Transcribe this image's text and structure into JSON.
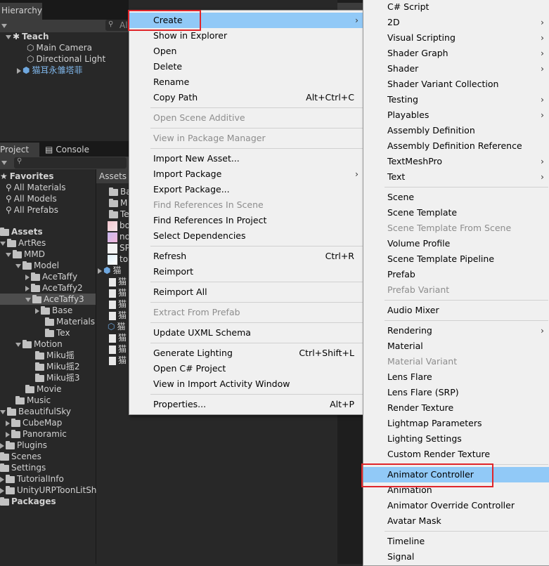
{
  "hierarchy": {
    "tab": "Hierarchy",
    "search_placeholder": "All",
    "scene": "Teach",
    "items": [
      "Main Camera",
      "Directional Light",
      "猫耳永雏塔菲"
    ]
  },
  "project": {
    "tab_project": "Project",
    "tab_console": "Console",
    "favorites": "Favorites",
    "fav_items": [
      "All Materials",
      "All Models",
      "All Prefabs"
    ],
    "assets": "Assets",
    "tree": [
      "ArtRes",
      "MMD",
      "Model",
      "AceTaffy",
      "AceTaffy2",
      "AceTaffy3",
      "Base",
      "Materials",
      "Tex",
      "Motion",
      "Miku摇",
      "Miku摇2",
      "Miku摇3",
      "Movie",
      "Music",
      "BeautifulSky",
      "CubeMap",
      "Panoramic",
      "Plugins",
      "Scenes",
      "Settings",
      "TutorialInfo",
      "UnityURPToonLitSh"
    ],
    "packages": "Packages",
    "breadcrumb": "Assets",
    "files": [
      "Ba",
      "M",
      "Te",
      "bo",
      "no",
      "SP",
      "to",
      "猫",
      "猫",
      "猫",
      "猫",
      "猫",
      "猫",
      "猫",
      "猫",
      "猫"
    ]
  },
  "context_menu": [
    {
      "label": "Create",
      "arrow": true,
      "hl": true
    },
    {
      "label": "Show in Explorer"
    },
    {
      "label": "Open"
    },
    {
      "label": "Delete"
    },
    {
      "label": "Rename"
    },
    {
      "label": "Copy Path",
      "shortcut": "Alt+Ctrl+C"
    },
    {
      "sep": true
    },
    {
      "label": "Open Scene Additive",
      "dis": true
    },
    {
      "sep": true
    },
    {
      "label": "View in Package Manager",
      "dis": true
    },
    {
      "sep": true
    },
    {
      "label": "Import New Asset..."
    },
    {
      "label": "Import Package",
      "arrow": true
    },
    {
      "label": "Export Package..."
    },
    {
      "label": "Find References In Scene",
      "dis": true
    },
    {
      "label": "Find References In Project"
    },
    {
      "label": "Select Dependencies"
    },
    {
      "sep": true
    },
    {
      "label": "Refresh",
      "shortcut": "Ctrl+R"
    },
    {
      "label": "Reimport"
    },
    {
      "sep": true
    },
    {
      "label": "Reimport All"
    },
    {
      "sep": true
    },
    {
      "label": "Extract From Prefab",
      "dis": true
    },
    {
      "sep": true
    },
    {
      "label": "Update UXML Schema"
    },
    {
      "sep": true
    },
    {
      "label": "Generate Lighting",
      "shortcut": "Ctrl+Shift+L"
    },
    {
      "label": "Open C# Project"
    },
    {
      "label": "View in Import Activity Window"
    },
    {
      "sep": true
    },
    {
      "label": "Properties...",
      "shortcut": "Alt+P"
    }
  ],
  "create_menu": [
    {
      "label": "C# Script"
    },
    {
      "label": "2D",
      "arrow": true
    },
    {
      "label": "Visual Scripting",
      "arrow": true
    },
    {
      "label": "Shader Graph",
      "arrow": true
    },
    {
      "label": "Shader",
      "arrow": true
    },
    {
      "label": "Shader Variant Collection"
    },
    {
      "label": "Testing",
      "arrow": true
    },
    {
      "label": "Playables",
      "arrow": true
    },
    {
      "label": "Assembly Definition"
    },
    {
      "label": "Assembly Definition Reference"
    },
    {
      "label": "TextMeshPro",
      "arrow": true
    },
    {
      "label": "Text",
      "arrow": true
    },
    {
      "sep": true
    },
    {
      "label": "Scene"
    },
    {
      "label": "Scene Template"
    },
    {
      "label": "Scene Template From Scene",
      "dis": true
    },
    {
      "label": "Volume Profile"
    },
    {
      "label": "Scene Template Pipeline"
    },
    {
      "label": "Prefab"
    },
    {
      "label": "Prefab Variant",
      "dis": true
    },
    {
      "sep": true
    },
    {
      "label": "Audio Mixer"
    },
    {
      "sep": true
    },
    {
      "label": "Rendering",
      "arrow": true
    },
    {
      "label": "Material"
    },
    {
      "label": "Material Variant",
      "dis": true
    },
    {
      "label": "Lens Flare"
    },
    {
      "label": "Lens Flare (SRP)"
    },
    {
      "label": "Render Texture"
    },
    {
      "label": "Lightmap Parameters"
    },
    {
      "label": "Lighting Settings"
    },
    {
      "label": "Custom Render Texture"
    },
    {
      "sep": true
    },
    {
      "label": "Animator Controller",
      "hl": true
    },
    {
      "label": "Animation"
    },
    {
      "label": "Animator Override Controller"
    },
    {
      "label": "Avatar Mask"
    },
    {
      "sep": true
    },
    {
      "label": "Timeline"
    },
    {
      "label": "Signal"
    }
  ]
}
